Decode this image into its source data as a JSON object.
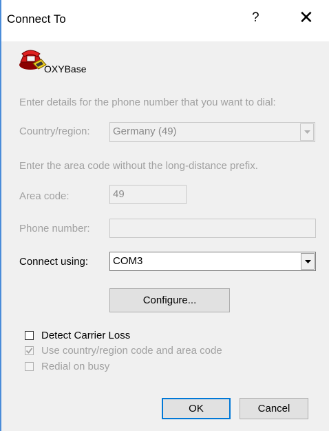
{
  "window": {
    "title": "Connect To",
    "help_glyph": "?",
    "close_glyph": "✕"
  },
  "connection": {
    "name": "OXYBase",
    "icon": "telephone-icon"
  },
  "instructions": {
    "phone": "Enter details for the phone number that you want to dial:",
    "area": "Enter the area code without the long-distance prefix."
  },
  "form": {
    "country_label": "Country/region:",
    "country_value": "Germany (49)",
    "area_label": "Area code:",
    "area_value": "49",
    "phone_label": "Phone number:",
    "phone_value": "",
    "connect_label": "Connect using:",
    "connect_value": "COM3"
  },
  "buttons": {
    "configure": "Configure...",
    "ok": "OK",
    "cancel": "Cancel"
  },
  "options": [
    {
      "label": "Detect Carrier Loss",
      "checked": false,
      "enabled": true
    },
    {
      "label": "Use country/region code and area code",
      "checked": true,
      "enabled": false
    },
    {
      "label": "Redial on busy",
      "checked": false,
      "enabled": false
    }
  ],
  "colors": {
    "accent": "#0078d7",
    "disabled_text": "#a0a0a0"
  }
}
